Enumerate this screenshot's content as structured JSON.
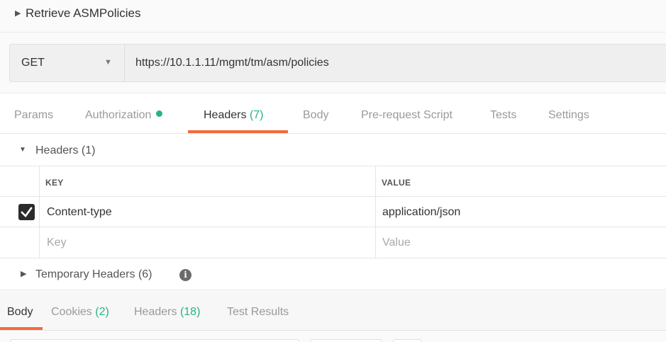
{
  "request": {
    "title": "Retrieve ASMPolicies",
    "method": "GET",
    "url": "https://10.1.1.11/mgmt/tm/asm/policies"
  },
  "request_tabs": {
    "params": "Params",
    "authorization": "Authorization",
    "headers": "Headers",
    "headers_count": "(7)",
    "body": "Body",
    "prerequest": "Pre-request Script",
    "tests": "Tests",
    "settings": "Settings"
  },
  "headers_section": {
    "label": "Headers (1)",
    "columns": {
      "key": "KEY",
      "value": "VALUE"
    },
    "rows": [
      {
        "key": "Content-type",
        "value": "application/json",
        "checked": true
      }
    ],
    "placeholder": {
      "key": "Key",
      "value": "Value"
    }
  },
  "temporary_headers": {
    "label": "Temporary Headers (6)"
  },
  "response_tabs": {
    "body": "Body",
    "cookies": "Cookies",
    "cookies_count": "(2)",
    "headers": "Headers",
    "headers_count": "(18)",
    "test_results": "Test Results"
  },
  "colors": {
    "accent": "#f26b3a",
    "count": "#26b47f"
  },
  "icons": {
    "title_caret": "caret-right-icon",
    "method_chevron": "chevron-down-icon",
    "section_caret": "caret-down-icon",
    "info": "info-icon",
    "check": "check-icon"
  }
}
